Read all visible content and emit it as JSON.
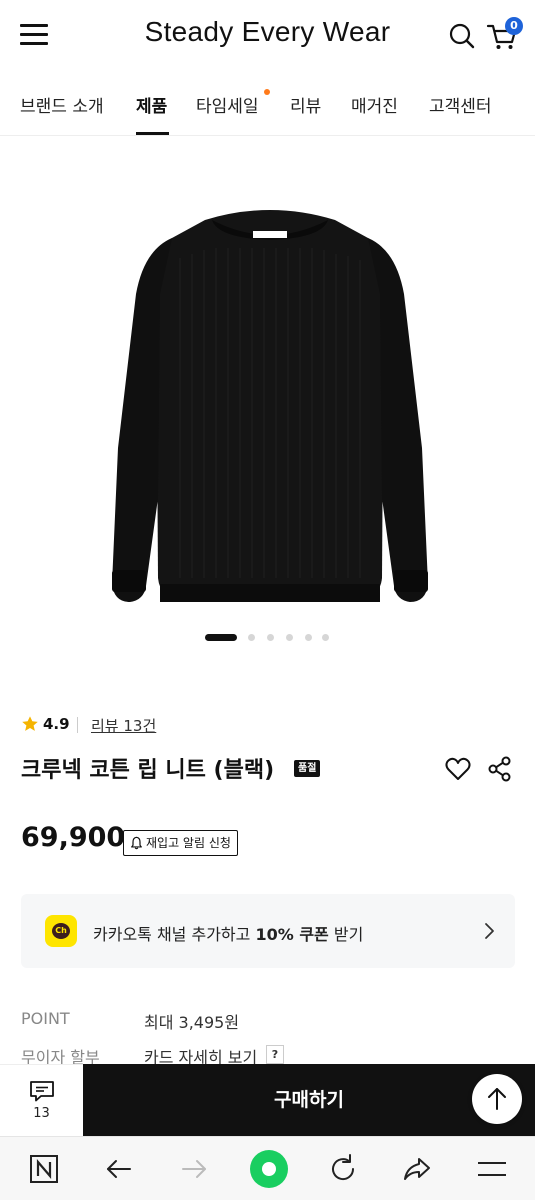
{
  "header": {
    "brand_title": "Steady Every Wear",
    "cart_count": "0"
  },
  "nav": {
    "items": [
      "브랜드 소개",
      "제품",
      "타임세일",
      "리뷰",
      "매거진",
      "고객센터"
    ],
    "active": "제품"
  },
  "product": {
    "rating": "4.9",
    "review_link": "리뷰 13건",
    "name": "크루넥 코튼 립 니트 (블랙)",
    "soldout_badge": "품절",
    "price": "69,900",
    "restock_button": "재입고 알림 신청",
    "carousel": {
      "total": 6,
      "active_index": 0
    }
  },
  "kakao_banner": {
    "icon_text": "Ch",
    "text_before": "카카오톡 채널 추가하고 ",
    "text_bold": "10% 쿠폰",
    "text_after": " 받기"
  },
  "info": {
    "point_label": "POINT",
    "point_value": "최대 3,495원",
    "installment_label": "무이자 할부",
    "installment_value": "카드 자세히 보기",
    "help_badge": "?"
  },
  "purchase_bar": {
    "comment_count": "13",
    "buy_label": "구매하기"
  },
  "colors": {
    "accent_blue": "#1e63d9",
    "nav_dot": "#ff7a1a",
    "kakao_yellow": "#fee500",
    "browser_green": "#19ce60"
  }
}
